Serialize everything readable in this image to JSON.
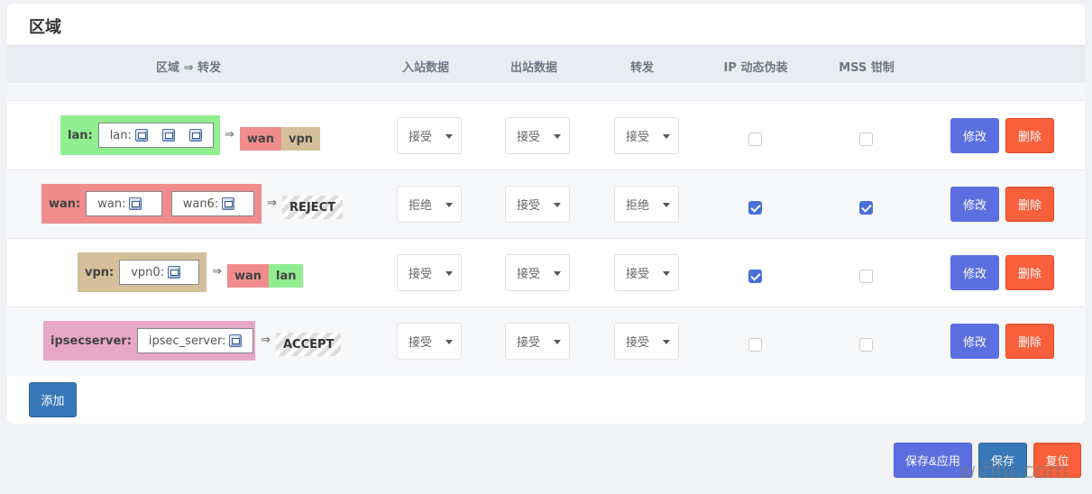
{
  "panel": {
    "title": "区域"
  },
  "header": {
    "zone_forward": "区域 ⇒ 转发",
    "input": "入站数据",
    "output": "出站数据",
    "forward": "转发",
    "masq": "IP 动态伪装",
    "mss": "MSS 钳制"
  },
  "arrow": "⇒",
  "rows": [
    {
      "zone": "lan:",
      "zone_color": "#90ee90",
      "devices": [
        "lan:"
      ],
      "targets": [
        "wan",
        "vpn"
      ],
      "input": "接受",
      "output": "接受",
      "forward": "接受",
      "masq": false,
      "mss": false,
      "edit": "修改",
      "delete": "删除"
    },
    {
      "zone": "wan:",
      "zone_color": "#f08c8c",
      "devices": [
        "wan:",
        "wan6:"
      ],
      "targets": [
        "REJECT"
      ],
      "input": "拒绝",
      "output": "接受",
      "forward": "拒绝",
      "masq": true,
      "mss": true,
      "edit": "修改",
      "delete": "删除"
    },
    {
      "zone": "vpn:",
      "zone_color": "#d4bf9a",
      "devices": [
        "vpn0:"
      ],
      "targets": [
        "wan",
        "lan"
      ],
      "input": "接受",
      "output": "接受",
      "forward": "接受",
      "masq": true,
      "mss": false,
      "edit": "修改",
      "delete": "删除"
    },
    {
      "zone": "ipsecserver:",
      "zone_color": "#e6a8c4",
      "devices": [
        "ipsec_server:"
      ],
      "targets": [
        "ACCEPT"
      ],
      "input": "接受",
      "output": "接受",
      "forward": "接受",
      "masq": false,
      "mss": false,
      "edit": "修改",
      "delete": "删除"
    }
  ],
  "add_label": "添加",
  "footer": {
    "save_apply": "保存&应用",
    "save": "保存",
    "reset": "复位"
  },
  "watermark": "wifilu.com",
  "colors": {
    "edit_button": "#5b6fe0",
    "delete_button": "#f95f3a",
    "add_button": "#3878b8",
    "checkbox_on": "#4a70d8",
    "wan_tag": "#f08c8c",
    "vpn_tag": "#d4bf9a",
    "lan_tag": "#90ee90"
  }
}
